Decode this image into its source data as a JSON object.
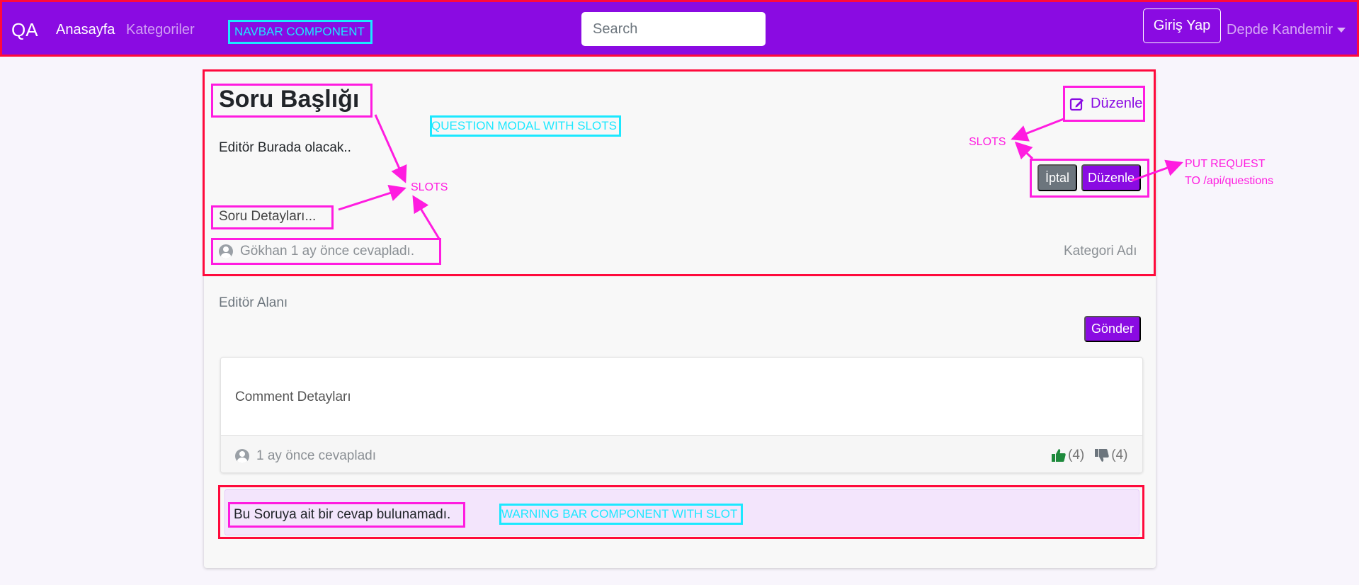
{
  "navbar": {
    "brand": "QA",
    "home_label": "Anasayfa",
    "categories_label": "Kategoriler",
    "search_placeholder": "Search",
    "login_label": "Giriş Yap",
    "user_name": "Depde Kandemir"
  },
  "question": {
    "title": "Soru Başlığı",
    "body": "Editör Burada olacak..",
    "details": "Soru Detayları...",
    "meta": "Gökhan 1 ay önce cevapladı.",
    "category": "Kategori Adı",
    "edit_label": "Düzenle",
    "cancel_label": "İptal",
    "save_label": "Düzenle"
  },
  "editor": {
    "label": "Editör Alanı",
    "send_label": "Gönder"
  },
  "comment": {
    "text": "Comment Detayları",
    "meta": "1 ay önce cevapladı",
    "upvotes": "(4)",
    "downvotes": "(4)"
  },
  "warning": {
    "text": "Bu Soruya ait bir cevap bulunamadı."
  },
  "annotations": {
    "navbar_component": "NAVBAR COMPONENT",
    "question_modal": "QUESTION MODAL WITH SLOTS",
    "warning_component": "WARNING BAR COMPONENT WITH SLOT",
    "slots_left": "SLOTS",
    "slots_right": "SLOTS",
    "put_request_line1": "PUT REQUEST",
    "put_request_line2": "TO /api/questions"
  },
  "colors": {
    "primary": "#8a0be2",
    "annotation_red": "#ff0a3c",
    "annotation_magenta": "#ff1ce0",
    "annotation_cyan": "#1ce8ff",
    "upvote_green": "#1e8a3c"
  }
}
